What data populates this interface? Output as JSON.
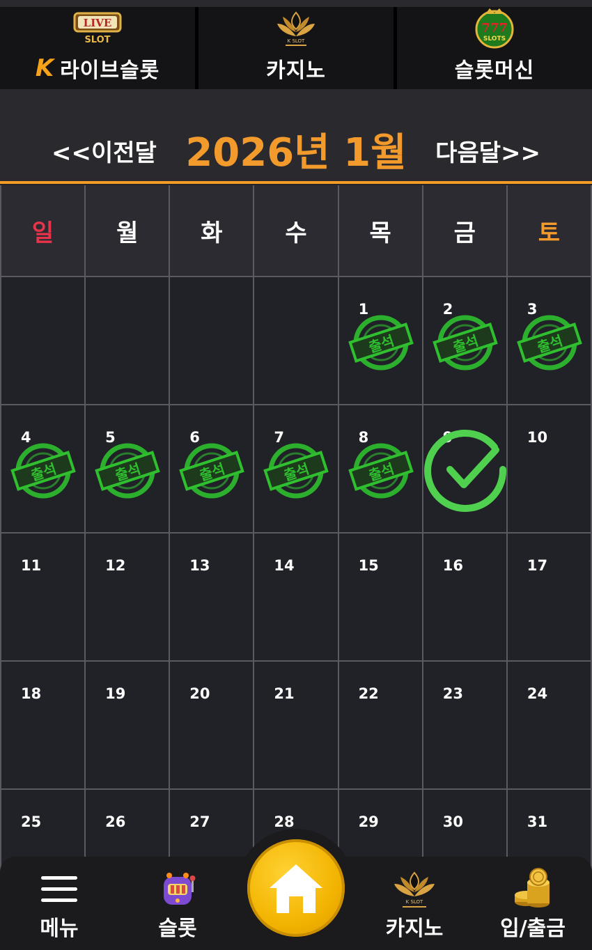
{
  "top_tabs": [
    {
      "logo_text": "LIVE",
      "logo_sub": "SLOT",
      "label": "라이브슬롯",
      "brand_mark": "K"
    },
    {
      "logo_text": "K SLOT",
      "label": "카지노"
    },
    {
      "logo_text": "777",
      "logo_sub": "SLOTS",
      "label": "슬롯머신"
    }
  ],
  "calendar": {
    "prev_label": "<<이전달",
    "next_label": "다음달>>",
    "title": "2026년 1월",
    "weekdays": [
      "일",
      "월",
      "화",
      "수",
      "목",
      "금",
      "토"
    ],
    "weekday_colors": {
      "sunday": "#e8334a",
      "saturday": "#f39a2c",
      "default": "#ffffff"
    },
    "stamp_text": "출석",
    "stamp_color": "#2fbf2f",
    "check_color": "#4fd04f",
    "days": [
      {
        "num": "",
        "state": "empty"
      },
      {
        "num": "",
        "state": "empty"
      },
      {
        "num": "",
        "state": "empty"
      },
      {
        "num": "",
        "state": "empty"
      },
      {
        "num": "1",
        "state": "stamp"
      },
      {
        "num": "2",
        "state": "stamp"
      },
      {
        "num": "3",
        "state": "stamp"
      },
      {
        "num": "4",
        "state": "stamp"
      },
      {
        "num": "5",
        "state": "stamp"
      },
      {
        "num": "6",
        "state": "stamp"
      },
      {
        "num": "7",
        "state": "stamp"
      },
      {
        "num": "8",
        "state": "stamp"
      },
      {
        "num": "9",
        "state": "check"
      },
      {
        "num": "10",
        "state": "none"
      },
      {
        "num": "11",
        "state": "none"
      },
      {
        "num": "12",
        "state": "none"
      },
      {
        "num": "13",
        "state": "none"
      },
      {
        "num": "14",
        "state": "none"
      },
      {
        "num": "15",
        "state": "none"
      },
      {
        "num": "16",
        "state": "none"
      },
      {
        "num": "17",
        "state": "none"
      },
      {
        "num": "18",
        "state": "none"
      },
      {
        "num": "19",
        "state": "none"
      },
      {
        "num": "20",
        "state": "none"
      },
      {
        "num": "21",
        "state": "none"
      },
      {
        "num": "22",
        "state": "none"
      },
      {
        "num": "23",
        "state": "none"
      },
      {
        "num": "24",
        "state": "none"
      },
      {
        "num": "25",
        "state": "none"
      },
      {
        "num": "26",
        "state": "none"
      },
      {
        "num": "27",
        "state": "none"
      },
      {
        "num": "28",
        "state": "none"
      },
      {
        "num": "29",
        "state": "none"
      },
      {
        "num": "30",
        "state": "none"
      },
      {
        "num": "31",
        "state": "none"
      }
    ]
  },
  "bottom_nav": {
    "menu_label": "메뉴",
    "slot_label": "슬롯",
    "casino_label": "카지노",
    "deposit_label": "입/출금",
    "casino_logo_text": "K SLOT",
    "home_icon": "home-icon"
  },
  "colors": {
    "accent": "#f39a2c",
    "background": "#232228",
    "home_button": "#f2b300"
  }
}
